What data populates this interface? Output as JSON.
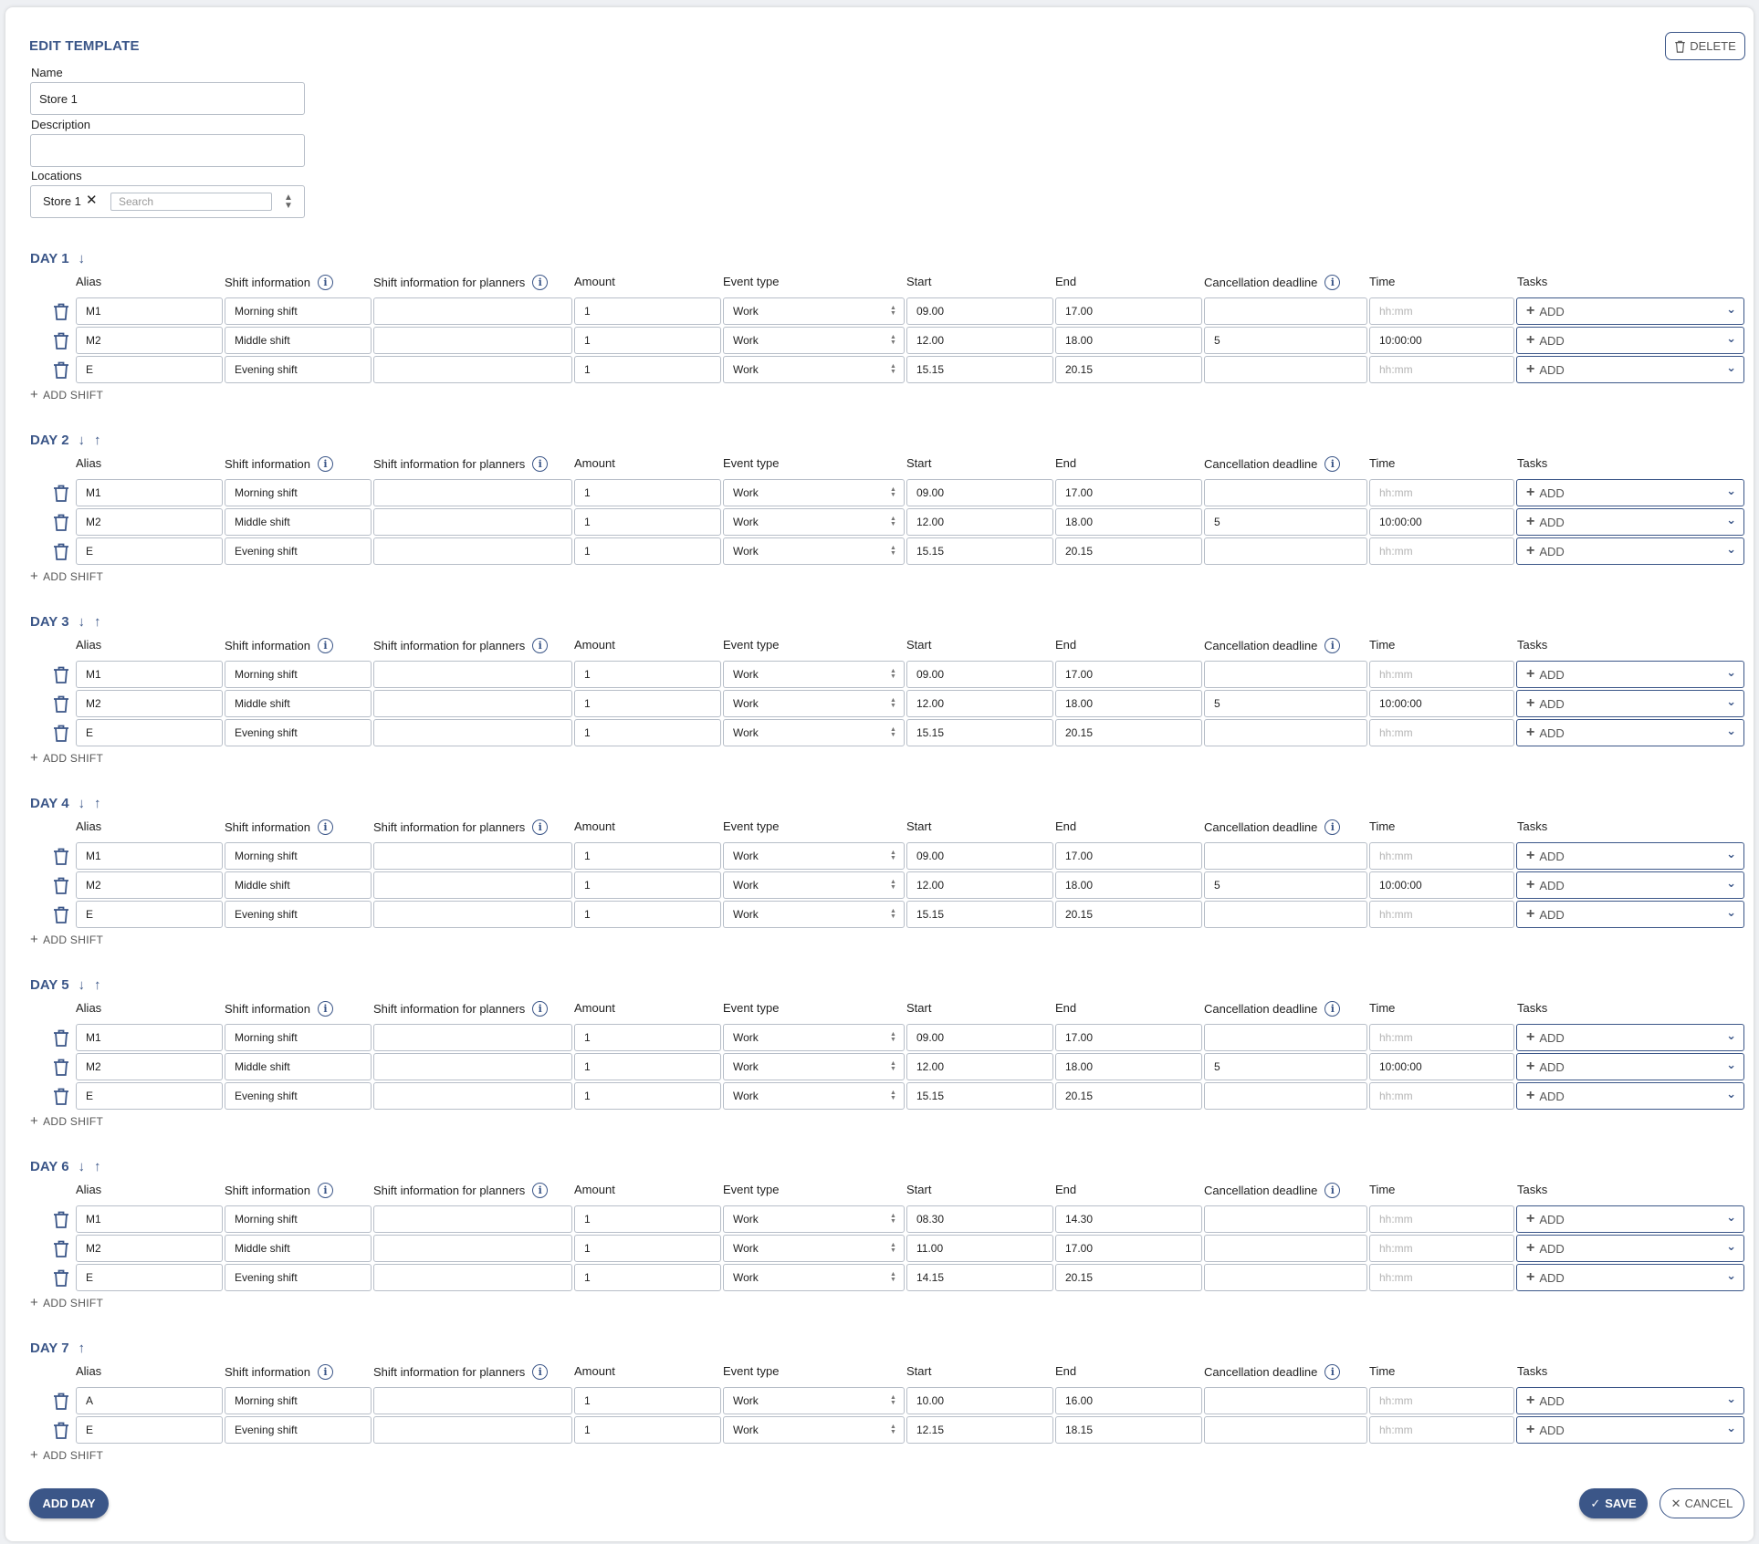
{
  "header": {
    "title": "EDIT TEMPLATE",
    "delete_label": "DELETE"
  },
  "form": {
    "name_label": "Name",
    "name_value": "Store 1",
    "description_label": "Description",
    "description_value": "",
    "locations_label": "Locations",
    "location_chip": "Store 1",
    "search_placeholder": "Search"
  },
  "columns": {
    "alias": "Alias",
    "shift_info": "Shift information",
    "shift_info_planners": "Shift information for planners",
    "amount": "Amount",
    "event_type": "Event type",
    "start": "Start",
    "end": "End",
    "cancellation": "Cancellation deadline",
    "time": "Time",
    "tasks": "Tasks"
  },
  "labels": {
    "add_shift": "ADD SHIFT",
    "add_task": "ADD",
    "time_placeholder": "hh:mm"
  },
  "days": [
    {
      "title": "DAY 1",
      "arrows": [
        "down"
      ],
      "shifts": [
        {
          "alias": "M1",
          "info": "Morning shift",
          "planners": "",
          "amount": "1",
          "event_type": "Work",
          "start": "09.00",
          "end": "17.00",
          "cancellation": "",
          "time": ""
        },
        {
          "alias": "M2",
          "info": "Middle shift",
          "planners": "",
          "amount": "1",
          "event_type": "Work",
          "start": "12.00",
          "end": "18.00",
          "cancellation": "5",
          "time": "10:00:00"
        },
        {
          "alias": "E",
          "info": "Evening shift",
          "planners": "",
          "amount": "1",
          "event_type": "Work",
          "start": "15.15",
          "end": "20.15",
          "cancellation": "",
          "time": ""
        }
      ]
    },
    {
      "title": "DAY 2",
      "arrows": [
        "down",
        "up"
      ],
      "shifts": [
        {
          "alias": "M1",
          "info": "Morning shift",
          "planners": "",
          "amount": "1",
          "event_type": "Work",
          "start": "09.00",
          "end": "17.00",
          "cancellation": "",
          "time": ""
        },
        {
          "alias": "M2",
          "info": "Middle shift",
          "planners": "",
          "amount": "1",
          "event_type": "Work",
          "start": "12.00",
          "end": "18.00",
          "cancellation": "5",
          "time": "10:00:00"
        },
        {
          "alias": "E",
          "info": "Evening shift",
          "planners": "",
          "amount": "1",
          "event_type": "Work",
          "start": "15.15",
          "end": "20.15",
          "cancellation": "",
          "time": ""
        }
      ]
    },
    {
      "title": "DAY 3",
      "arrows": [
        "down",
        "up"
      ],
      "shifts": [
        {
          "alias": "M1",
          "info": "Morning shift",
          "planners": "",
          "amount": "1",
          "event_type": "Work",
          "start": "09.00",
          "end": "17.00",
          "cancellation": "",
          "time": ""
        },
        {
          "alias": "M2",
          "info": "Middle shift",
          "planners": "",
          "amount": "1",
          "event_type": "Work",
          "start": "12.00",
          "end": "18.00",
          "cancellation": "5",
          "time": "10:00:00"
        },
        {
          "alias": "E",
          "info": "Evening shift",
          "planners": "",
          "amount": "1",
          "event_type": "Work",
          "start": "15.15",
          "end": "20.15",
          "cancellation": "",
          "time": ""
        }
      ]
    },
    {
      "title": "DAY 4",
      "arrows": [
        "down",
        "up"
      ],
      "shifts": [
        {
          "alias": "M1",
          "info": "Morning shift",
          "planners": "",
          "amount": "1",
          "event_type": "Work",
          "start": "09.00",
          "end": "17.00",
          "cancellation": "",
          "time": ""
        },
        {
          "alias": "M2",
          "info": "Middle shift",
          "planners": "",
          "amount": "1",
          "event_type": "Work",
          "start": "12.00",
          "end": "18.00",
          "cancellation": "5",
          "time": "10:00:00"
        },
        {
          "alias": "E",
          "info": "Evening shift",
          "planners": "",
          "amount": "1",
          "event_type": "Work",
          "start": "15.15",
          "end": "20.15",
          "cancellation": "",
          "time": ""
        }
      ]
    },
    {
      "title": "DAY 5",
      "arrows": [
        "down",
        "up"
      ],
      "shifts": [
        {
          "alias": "M1",
          "info": "Morning shift",
          "planners": "",
          "amount": "1",
          "event_type": "Work",
          "start": "09.00",
          "end": "17.00",
          "cancellation": "",
          "time": ""
        },
        {
          "alias": "M2",
          "info": "Middle shift",
          "planners": "",
          "amount": "1",
          "event_type": "Work",
          "start": "12.00",
          "end": "18.00",
          "cancellation": "5",
          "time": "10:00:00"
        },
        {
          "alias": "E",
          "info": "Evening shift",
          "planners": "",
          "amount": "1",
          "event_type": "Work",
          "start": "15.15",
          "end": "20.15",
          "cancellation": "",
          "time": ""
        }
      ]
    },
    {
      "title": "DAY 6",
      "arrows": [
        "down",
        "up"
      ],
      "shifts": [
        {
          "alias": "M1",
          "info": "Morning shift",
          "planners": "",
          "amount": "1",
          "event_type": "Work",
          "start": "08.30",
          "end": "14.30",
          "cancellation": "",
          "time": ""
        },
        {
          "alias": "M2",
          "info": "Middle shift",
          "planners": "",
          "amount": "1",
          "event_type": "Work",
          "start": "11.00",
          "end": "17.00",
          "cancellation": "",
          "time": ""
        },
        {
          "alias": "E",
          "info": "Evening shift",
          "planners": "",
          "amount": "1",
          "event_type": "Work",
          "start": "14.15",
          "end": "20.15",
          "cancellation": "",
          "time": ""
        }
      ]
    },
    {
      "title": "DAY 7",
      "arrows": [
        "up"
      ],
      "shifts": [
        {
          "alias": "A",
          "info": "Morning shift",
          "planners": "",
          "amount": "1",
          "event_type": "Work",
          "start": "10.00",
          "end": "16.00",
          "cancellation": "",
          "time": ""
        },
        {
          "alias": "E",
          "info": "Evening shift",
          "planners": "",
          "amount": "1",
          "event_type": "Work",
          "start": "12.15",
          "end": "18.15",
          "cancellation": "",
          "time": ""
        }
      ]
    }
  ],
  "footer": {
    "add_day": "ADD DAY",
    "save": "SAVE",
    "cancel": "CANCEL"
  },
  "colors": {
    "accent": "#3b5688",
    "border": "#b7bec8",
    "placeholder": "#b3b3b3"
  }
}
